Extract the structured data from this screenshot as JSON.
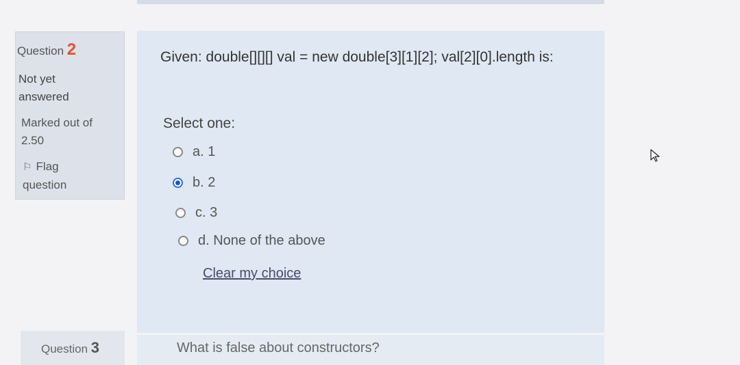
{
  "question": {
    "label": "Question",
    "number": "2",
    "state": "Not yet answered",
    "marks": "Marked out of 2.50",
    "flag_label": "Flag question",
    "text": "Given: double[][][] val = new double[3][1][2];  val[2][0].length is:",
    "select_prompt": "Select one:",
    "options": [
      {
        "label": "a. 1",
        "selected": false
      },
      {
        "label": "b. 2",
        "selected": true
      },
      {
        "label": "c. 3",
        "selected": false
      },
      {
        "label": "d. None of the above",
        "selected": false
      }
    ],
    "clear_choice": "Clear my choice"
  },
  "next_question": {
    "label": "Question",
    "number": "3",
    "text": "What is false about constructors?"
  },
  "colors": {
    "accent": "#e5512a",
    "radio_selected": "#1a57c4",
    "info_bg": "#dde1ea",
    "content_bg": "#dfe8f3"
  },
  "icons": {
    "flag": "flag-icon",
    "cursor": "mouse-pointer-icon"
  }
}
